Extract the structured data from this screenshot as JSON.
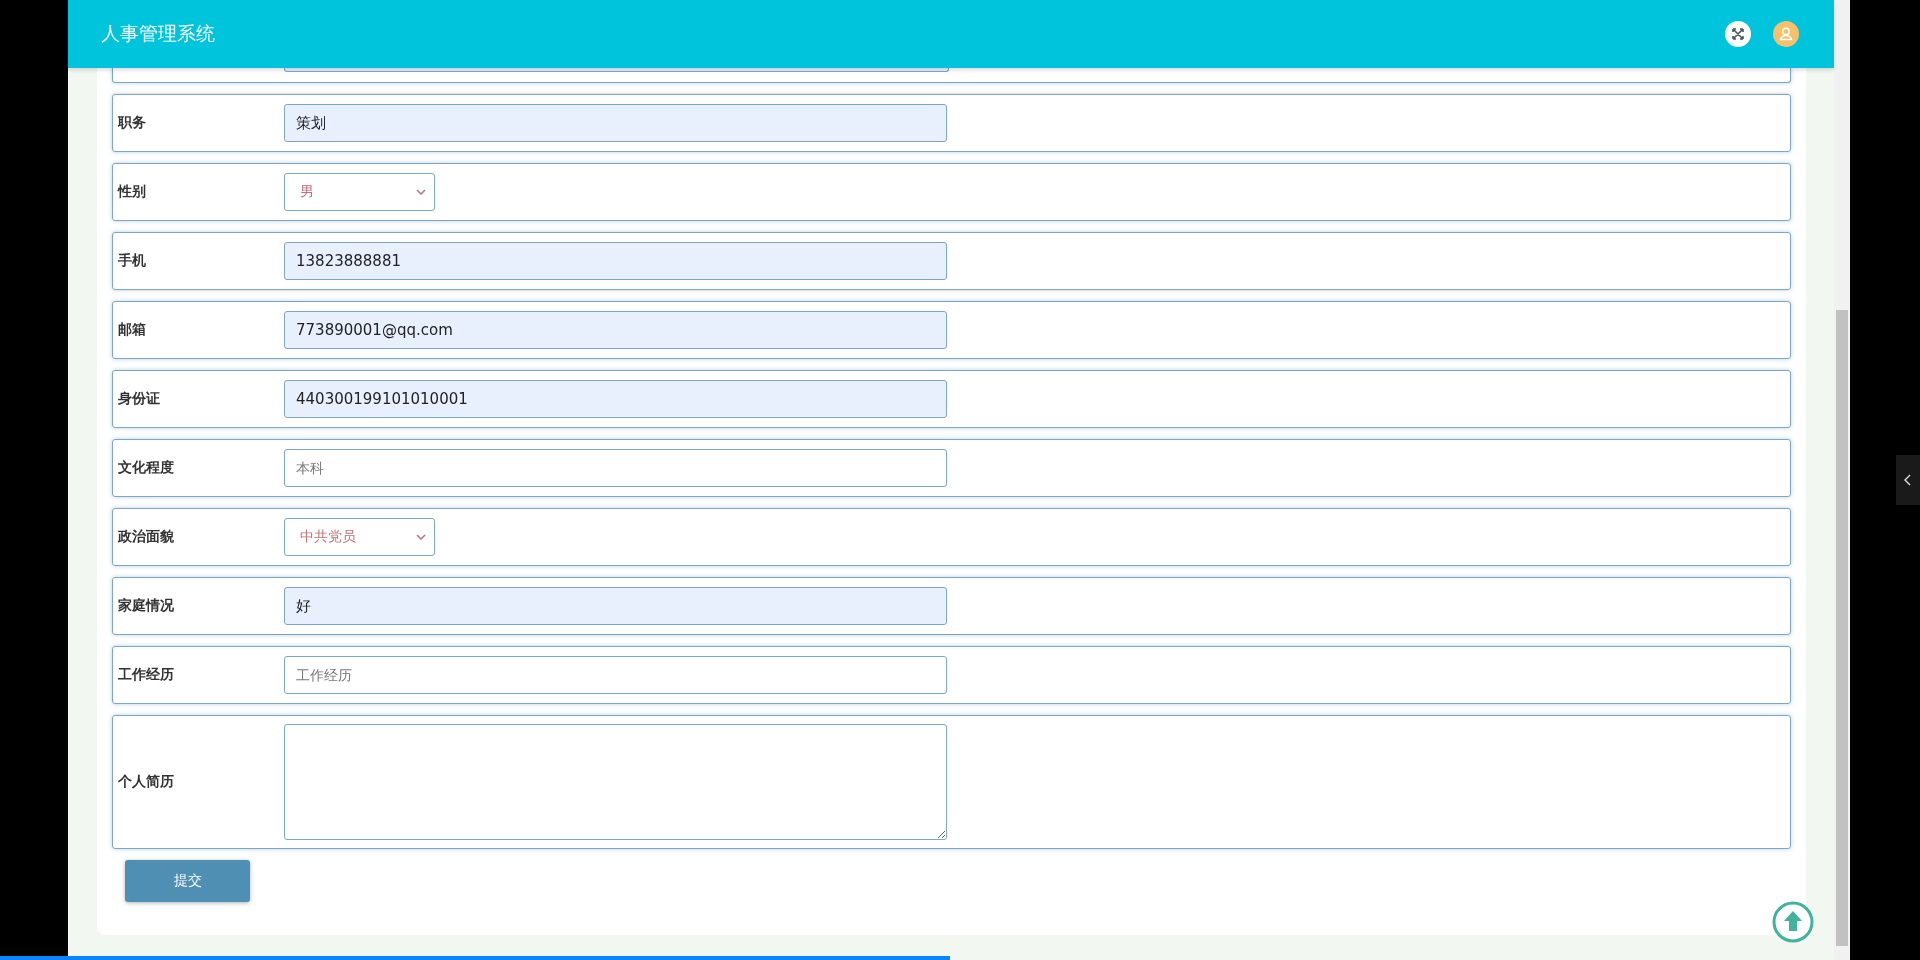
{
  "header": {
    "title": "人事管理系统"
  },
  "fields": [
    {
      "label": "职务",
      "kind": "input",
      "value": "策划"
    },
    {
      "label": "性别",
      "kind": "select",
      "value": "男"
    },
    {
      "label": "手机",
      "kind": "input",
      "value": "13823888881"
    },
    {
      "label": "邮箱",
      "kind": "input",
      "value": "773890001@qq.com"
    },
    {
      "label": "身份证",
      "kind": "input",
      "value": "440300199101010001"
    },
    {
      "label": "文化程度",
      "kind": "input",
      "placeholder": "本科"
    },
    {
      "label": "政治面貌",
      "kind": "select",
      "value": "中共党员"
    },
    {
      "label": "家庭情况",
      "kind": "input",
      "value": "好"
    },
    {
      "label": "工作经历",
      "kind": "input",
      "placeholder": "工作经历"
    },
    {
      "label": "个人简历",
      "kind": "textarea"
    }
  ],
  "submit": "提交",
  "player": {
    "level": 0.495
  }
}
